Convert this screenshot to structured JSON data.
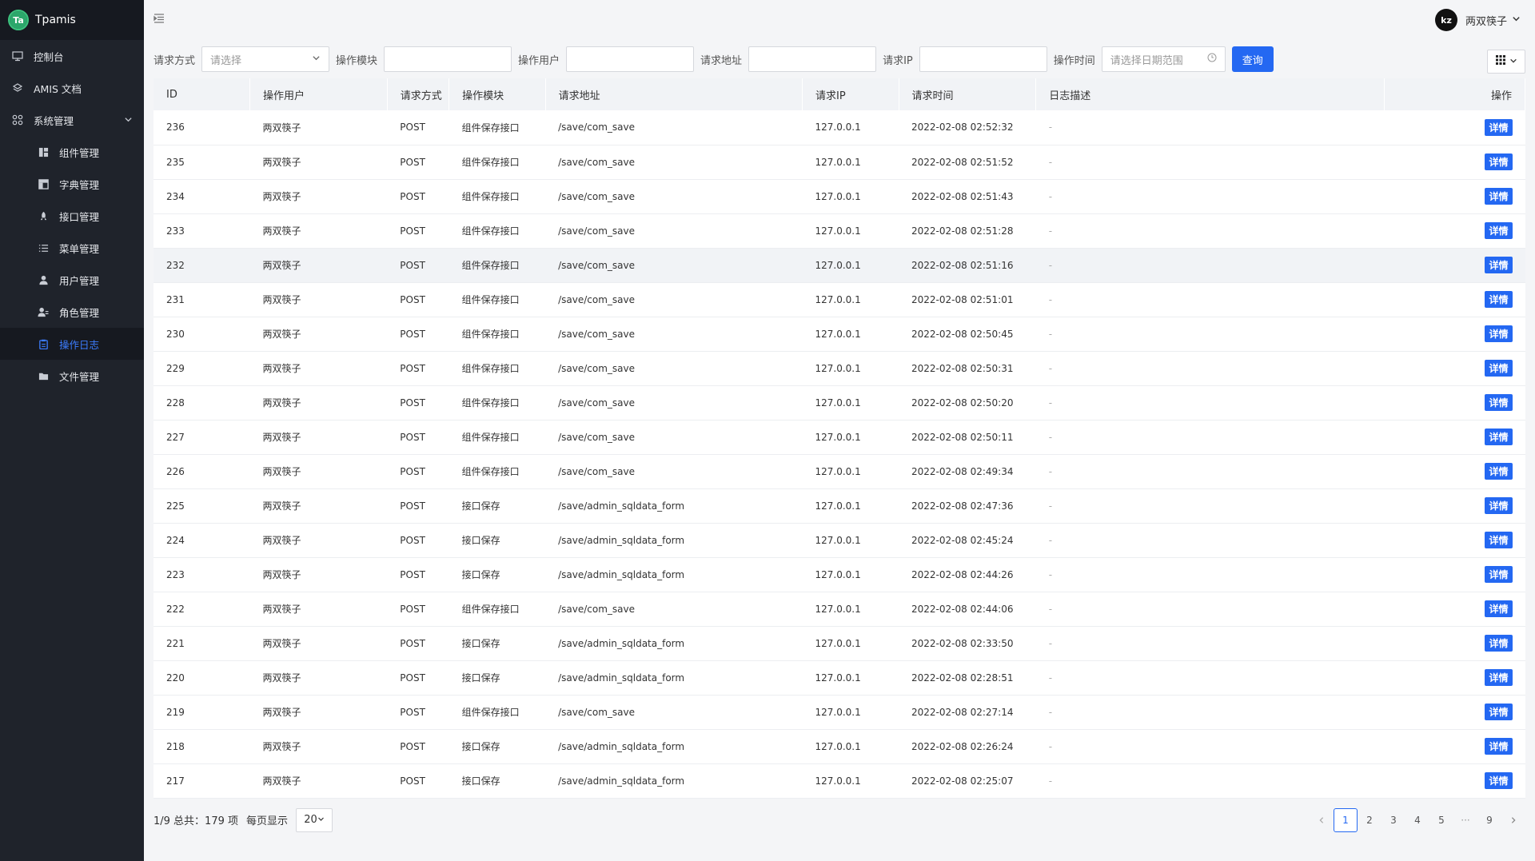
{
  "brand": {
    "logo_text": "Ta",
    "name": "Tpamis"
  },
  "sidebar": {
    "items": [
      {
        "label": "控制台",
        "icon": "monitor-icon",
        "sub": false
      },
      {
        "label": "AMIS 文档",
        "icon": "book-icon",
        "sub": false
      },
      {
        "label": "系统管理",
        "icon": "apps-icon",
        "sub": false
      },
      {
        "label": "组件管理",
        "icon": "layout-icon",
        "sub": true
      },
      {
        "label": "字典管理",
        "icon": "table-icon",
        "sub": true
      },
      {
        "label": "接口管理",
        "icon": "rocket-icon",
        "sub": true
      },
      {
        "label": "菜单管理",
        "icon": "list-icon",
        "sub": true
      },
      {
        "label": "用户管理",
        "icon": "user-icon",
        "sub": true
      },
      {
        "label": "角色管理",
        "icon": "user-role-icon",
        "sub": true
      },
      {
        "label": "操作日志",
        "icon": "clipboard-icon",
        "sub": true
      },
      {
        "label": "文件管理",
        "icon": "folder-icon",
        "sub": true
      }
    ],
    "active_label": "操作日志"
  },
  "header": {
    "avatar_text": "kz",
    "user_name": "两双筷子"
  },
  "filters": {
    "method_label": "请求方式",
    "method_placeholder": "请选择",
    "module_label": "操作模块",
    "user_label": "操作用户",
    "url_label": "请求地址",
    "ip_label": "请求IP",
    "time_label": "操作时间",
    "time_placeholder": "请选择日期范围",
    "query_label": "查询"
  },
  "table": {
    "columns": [
      "ID",
      "操作用户",
      "请求方式",
      "操作模块",
      "请求地址",
      "请求IP",
      "请求时间",
      "日志描述",
      "操作"
    ],
    "detail_label": "详情",
    "rows": [
      [
        "236",
        "两双筷子",
        "POST",
        "组件保存接口",
        "/save/com_save",
        "127.0.0.1",
        "2022-02-08 02:52:32",
        "-"
      ],
      [
        "235",
        "两双筷子",
        "POST",
        "组件保存接口",
        "/save/com_save",
        "127.0.0.1",
        "2022-02-08 02:51:52",
        "-"
      ],
      [
        "234",
        "两双筷子",
        "POST",
        "组件保存接口",
        "/save/com_save",
        "127.0.0.1",
        "2022-02-08 02:51:43",
        "-"
      ],
      [
        "233",
        "两双筷子",
        "POST",
        "组件保存接口",
        "/save/com_save",
        "127.0.0.1",
        "2022-02-08 02:51:28",
        "-"
      ],
      [
        "232",
        "两双筷子",
        "POST",
        "组件保存接口",
        "/save/com_save",
        "127.0.0.1",
        "2022-02-08 02:51:16",
        "-"
      ],
      [
        "231",
        "两双筷子",
        "POST",
        "组件保存接口",
        "/save/com_save",
        "127.0.0.1",
        "2022-02-08 02:51:01",
        "-"
      ],
      [
        "230",
        "两双筷子",
        "POST",
        "组件保存接口",
        "/save/com_save",
        "127.0.0.1",
        "2022-02-08 02:50:45",
        "-"
      ],
      [
        "229",
        "两双筷子",
        "POST",
        "组件保存接口",
        "/save/com_save",
        "127.0.0.1",
        "2022-02-08 02:50:31",
        "-"
      ],
      [
        "228",
        "两双筷子",
        "POST",
        "组件保存接口",
        "/save/com_save",
        "127.0.0.1",
        "2022-02-08 02:50:20",
        "-"
      ],
      [
        "227",
        "两双筷子",
        "POST",
        "组件保存接口",
        "/save/com_save",
        "127.0.0.1",
        "2022-02-08 02:50:11",
        "-"
      ],
      [
        "226",
        "两双筷子",
        "POST",
        "组件保存接口",
        "/save/com_save",
        "127.0.0.1",
        "2022-02-08 02:49:34",
        "-"
      ],
      [
        "225",
        "两双筷子",
        "POST",
        "接口保存",
        "/save/admin_sqldata_form",
        "127.0.0.1",
        "2022-02-08 02:47:36",
        "-"
      ],
      [
        "224",
        "两双筷子",
        "POST",
        "接口保存",
        "/save/admin_sqldata_form",
        "127.0.0.1",
        "2022-02-08 02:45:24",
        "-"
      ],
      [
        "223",
        "两双筷子",
        "POST",
        "接口保存",
        "/save/admin_sqldata_form",
        "127.0.0.1",
        "2022-02-08 02:44:26",
        "-"
      ],
      [
        "222",
        "两双筷子",
        "POST",
        "组件保存接口",
        "/save/com_save",
        "127.0.0.1",
        "2022-02-08 02:44:06",
        "-"
      ],
      [
        "221",
        "两双筷子",
        "POST",
        "接口保存",
        "/save/admin_sqldata_form",
        "127.0.0.1",
        "2022-02-08 02:33:50",
        "-"
      ],
      [
        "220",
        "两双筷子",
        "POST",
        "接口保存",
        "/save/admin_sqldata_form",
        "127.0.0.1",
        "2022-02-08 02:28:51",
        "-"
      ],
      [
        "219",
        "两双筷子",
        "POST",
        "组件保存接口",
        "/save/com_save",
        "127.0.0.1",
        "2022-02-08 02:27:14",
        "-"
      ],
      [
        "218",
        "两双筷子",
        "POST",
        "接口保存",
        "/save/admin_sqldata_form",
        "127.0.0.1",
        "2022-02-08 02:26:24",
        "-"
      ],
      [
        "217",
        "两双筷子",
        "POST",
        "接口保存",
        "/save/admin_sqldata_form",
        "127.0.0.1",
        "2022-02-08 02:25:07",
        "-"
      ]
    ],
    "highlighted_row_id": "232"
  },
  "footer": {
    "summary": "1/9 总共：179 项",
    "per_page_label": "每页显示",
    "per_page_value": "20",
    "pages": [
      "1",
      "2",
      "3",
      "4",
      "5",
      "···",
      "9"
    ],
    "current_page": "1"
  },
  "colors": {
    "sidebar_bg": "#1f232b",
    "accent": "#2468f2",
    "brand_green": "#2ca76b"
  }
}
